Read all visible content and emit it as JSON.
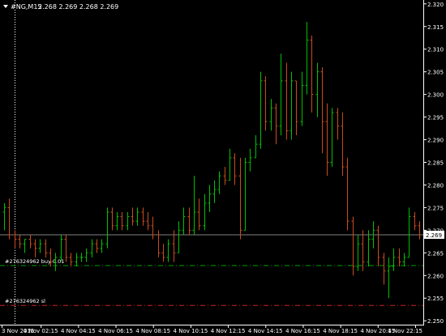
{
  "header": {
    "symbol": "#NG,M15",
    "ohlc": "2.268 2.269 2.268 2.269"
  },
  "colors": {
    "background": "#000000",
    "bull": "#00c000",
    "bear": "#c84c1e",
    "grid_vertical": "#ffffff",
    "price_line": "#808080",
    "buy_line": "#00a000",
    "sl_line": "#d02020",
    "current_price_box": "#ffffff",
    "axis_text": "#ffffff"
  },
  "orders": [
    {
      "label": "#276324962 buy 0.01",
      "price": 2.2622,
      "type": "buy"
    },
    {
      "label": "#276324962 sl",
      "price": 2.2534,
      "type": "sl"
    }
  ],
  "current_price_label": "2.269",
  "chart_data": {
    "type": "ohlc",
    "title": "",
    "ylim": [
      2.2495,
      2.3205
    ],
    "y_ticks": [
      "2.320",
      "2.315",
      "2.310",
      "2.305",
      "2.300",
      "2.295",
      "2.290",
      "2.285",
      "2.280",
      "2.275",
      "2.270",
      "2.265",
      "2.260",
      "2.255",
      "2.250"
    ],
    "x_tick_labels": [
      "3 Nov 2015",
      "4 Nov 02:15",
      "4 Nov 04:15",
      "4 Nov 06:15",
      "4 Nov 08:15",
      "4 Nov 10:15",
      "4 Nov 12:15",
      "4 Nov 14:15",
      "4 Nov 16:15",
      "4 Nov 18:15",
      "4 Nov 20:15",
      "4 Nov 22:15"
    ],
    "current_price": 2.269,
    "bars": [
      [
        2.274,
        2.276,
        2.27,
        2.275
      ],
      [
        2.275,
        2.277,
        2.268,
        2.269
      ],
      [
        2.269,
        2.27,
        2.266,
        2.268
      ],
      [
        2.268,
        2.269,
        2.266,
        2.267
      ],
      [
        2.267,
        2.268,
        2.265,
        2.268
      ],
      [
        2.268,
        2.269,
        2.266,
        2.267
      ],
      [
        2.267,
        2.268,
        2.264,
        2.266
      ],
      [
        2.266,
        2.268,
        2.265,
        2.267
      ],
      [
        2.267,
        2.268,
        2.264,
        2.265
      ],
      [
        2.265,
        2.266,
        2.262,
        2.263
      ],
      [
        2.263,
        2.265,
        2.261,
        2.264
      ],
      [
        2.264,
        2.269,
        2.263,
        2.268
      ],
      [
        2.268,
        2.269,
        2.263,
        2.264
      ],
      [
        2.264,
        2.265,
        2.262,
        2.263
      ],
      [
        2.263,
        2.265,
        2.262,
        2.264
      ],
      [
        2.264,
        2.265,
        2.263,
        2.264
      ],
      [
        2.264,
        2.266,
        2.263,
        2.265
      ],
      [
        2.265,
        2.268,
        2.264,
        2.267
      ],
      [
        2.267,
        2.268,
        2.265,
        2.266
      ],
      [
        2.266,
        2.268,
        2.265,
        2.267
      ],
      [
        2.267,
        2.275,
        2.266,
        2.274
      ],
      [
        2.274,
        2.275,
        2.27,
        2.271
      ],
      [
        2.271,
        2.274,
        2.27,
        2.273
      ],
      [
        2.273,
        2.274,
        2.27,
        2.271
      ],
      [
        2.271,
        2.274,
        2.27,
        2.273
      ],
      [
        2.273,
        2.275,
        2.271,
        2.272
      ],
      [
        2.272,
        2.275,
        2.271,
        2.274
      ],
      [
        2.274,
        2.275,
        2.271,
        2.272
      ],
      [
        2.272,
        2.274,
        2.27,
        2.271
      ],
      [
        2.271,
        2.273,
        2.268,
        2.269
      ],
      [
        2.269,
        2.27,
        2.264,
        2.265
      ],
      [
        2.265,
        2.267,
        2.263,
        2.264
      ],
      [
        2.264,
        2.268,
        2.263,
        2.267
      ],
      [
        2.267,
        2.27,
        2.263,
        2.265
      ],
      [
        2.265,
        2.272,
        2.265,
        2.27
      ],
      [
        2.27,
        2.275,
        2.269,
        2.273
      ],
      [
        2.273,
        2.275,
        2.269,
        2.27
      ],
      [
        2.27,
        2.282,
        2.269,
        2.274
      ],
      [
        2.274,
        2.277,
        2.27,
        2.271
      ],
      [
        2.271,
        2.278,
        2.27,
        2.276
      ],
      [
        2.276,
        2.28,
        2.274,
        2.278
      ],
      [
        2.278,
        2.281,
        2.276,
        2.279
      ],
      [
        2.279,
        2.283,
        2.278,
        2.282
      ],
      [
        2.282,
        2.284,
        2.28,
        2.281
      ],
      [
        2.281,
        2.288,
        2.281,
        2.286
      ],
      [
        2.286,
        2.287,
        2.28,
        2.282
      ],
      [
        2.282,
        2.286,
        2.268,
        2.27
      ],
      [
        2.27,
        2.286,
        2.27,
        2.285
      ],
      [
        2.285,
        2.288,
        2.283,
        2.286
      ],
      [
        2.286,
        2.291,
        2.286,
        2.289
      ],
      [
        2.289,
        2.305,
        2.288,
        2.303
      ],
      [
        2.303,
        2.304,
        2.292,
        2.294
      ],
      [
        2.294,
        2.299,
        2.292,
        2.297
      ],
      [
        2.297,
        2.298,
        2.289,
        2.293
      ],
      [
        2.293,
        2.309,
        2.291,
        2.303
      ],
      [
        2.303,
        2.307,
        2.29,
        2.292
      ],
      [
        2.292,
        2.305,
        2.29,
        2.303
      ],
      [
        2.303,
        2.303,
        2.291,
        2.294
      ],
      [
        2.294,
        2.305,
        2.293,
        2.302
      ],
      [
        2.302,
        2.316,
        2.3,
        2.312
      ],
      [
        2.312,
        2.313,
        2.296,
        2.3
      ],
      [
        2.3,
        2.307,
        2.295,
        2.305
      ],
      [
        2.305,
        2.306,
        2.287,
        2.294
      ],
      [
        2.294,
        2.298,
        2.282,
        2.285
      ],
      [
        2.285,
        2.297,
        2.284,
        2.296
      ],
      [
        2.296,
        2.297,
        2.29,
        2.293
      ],
      [
        2.293,
        2.296,
        2.282,
        2.284
      ],
      [
        2.284,
        2.286,
        2.27,
        2.272
      ],
      [
        2.272,
        2.273,
        2.26,
        2.262
      ],
      [
        2.262,
        2.269,
        2.261,
        2.267
      ],
      [
        2.267,
        2.27,
        2.261,
        2.263
      ],
      [
        2.263,
        2.27,
        2.262,
        2.268
      ],
      [
        2.268,
        2.272,
        2.266,
        2.27
      ],
      [
        2.27,
        2.271,
        2.262,
        2.264
      ],
      [
        2.264,
        2.265,
        2.258,
        2.261
      ],
      [
        2.261,
        2.264,
        2.255,
        2.262
      ],
      [
        2.262,
        2.266,
        2.261,
        2.264
      ],
      [
        2.264,
        2.266,
        2.262,
        2.263
      ],
      [
        2.263,
        2.265,
        2.262,
        2.264
      ],
      [
        2.264,
        2.275,
        2.264,
        2.273
      ],
      [
        2.273,
        2.274,
        2.27,
        2.271
      ],
      [
        2.271,
        2.272,
        2.268,
        2.269
      ]
    ]
  }
}
